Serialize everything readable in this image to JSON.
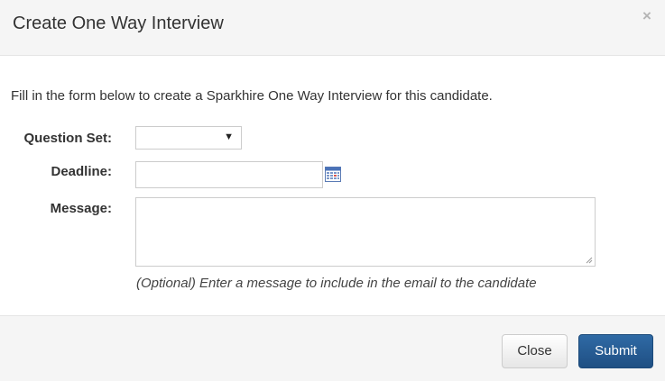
{
  "modal": {
    "title": "Create One Way Interview",
    "close_icon": "×"
  },
  "form": {
    "intro": "Fill in the form below to create a Sparkhire One Way Interview for this candidate.",
    "question_set": {
      "label": "Question Set:",
      "value": ""
    },
    "deadline": {
      "label": "Deadline:",
      "value": ""
    },
    "message": {
      "label": "Message:",
      "value": "",
      "help": "(Optional) Enter a message to include in the email to the candidate"
    }
  },
  "footer": {
    "close_label": "Close",
    "submit_label": "Submit"
  },
  "icons": {
    "calendar": "calendar-icon",
    "dropdown": "caret-down-icon"
  },
  "colors": {
    "primary": "#2a6099",
    "header_bg": "#f5f5f5"
  }
}
